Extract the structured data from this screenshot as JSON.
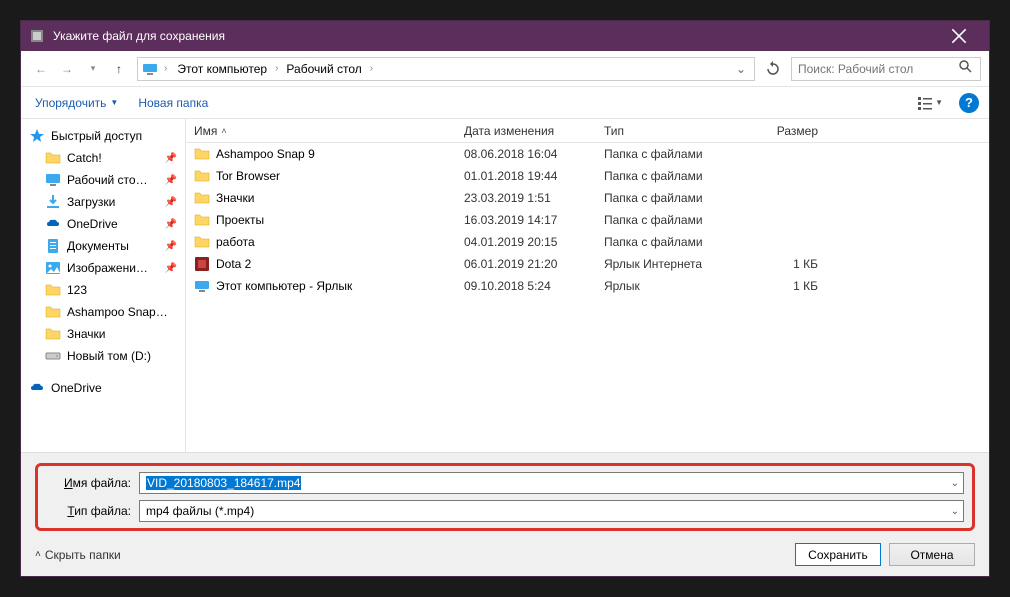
{
  "titlebar": {
    "title": "Укажите файл для сохранения"
  },
  "breadcrumb": {
    "root": "Этот компьютер",
    "items": [
      "Рабочий стол"
    ]
  },
  "search": {
    "placeholder": "Поиск: Рабочий стол"
  },
  "toolbar": {
    "organize": "Упорядочить",
    "new_folder": "Новая папка"
  },
  "columns": {
    "name": "Имя",
    "date": "Дата изменения",
    "type": "Тип",
    "size": "Размер"
  },
  "sidebar": {
    "quick_access": "Быстрый доступ",
    "items": [
      {
        "label": "Catch!",
        "icon": "folder",
        "pinned": true
      },
      {
        "label": "Рабочий сто…",
        "icon": "desktop",
        "pinned": true
      },
      {
        "label": "Загрузки",
        "icon": "download",
        "pinned": true
      },
      {
        "label": "OneDrive",
        "icon": "onedrive",
        "pinned": true
      },
      {
        "label": "Документы",
        "icon": "doc",
        "pinned": true
      },
      {
        "label": "Изображени…",
        "icon": "img",
        "pinned": true
      },
      {
        "label": "123",
        "icon": "folder",
        "pinned": false
      },
      {
        "label": "Ashampoo Snap…",
        "icon": "folder",
        "pinned": false
      },
      {
        "label": "Значки",
        "icon": "folder",
        "pinned": false
      },
      {
        "label": "Новый том (D:)",
        "icon": "drive",
        "pinned": false
      }
    ],
    "onedrive": "OneDrive"
  },
  "files": [
    {
      "name": "Ashampoo Snap 9",
      "date": "08.06.2018 16:04",
      "type": "Папка с файлами",
      "size": "",
      "icon": "folder"
    },
    {
      "name": "Tor Browser",
      "date": "01.01.2018 19:44",
      "type": "Папка с файлами",
      "size": "",
      "icon": "folder"
    },
    {
      "name": "Значки",
      "date": "23.03.2019 1:51",
      "type": "Папка с файлами",
      "size": "",
      "icon": "folder"
    },
    {
      "name": "Проекты",
      "date": "16.03.2019 14:17",
      "type": "Папка с файлами",
      "size": "",
      "icon": "folder"
    },
    {
      "name": "работа",
      "date": "04.01.2019 20:15",
      "type": "Папка с файлами",
      "size": "",
      "icon": "folder"
    },
    {
      "name": "Dota 2",
      "date": "06.01.2019 21:20",
      "type": "Ярлык Интернета",
      "size": "1 КБ",
      "icon": "shortcut-red"
    },
    {
      "name": "Этот компьютер - Ярлык",
      "date": "09.10.2018 5:24",
      "type": "Ярлык",
      "size": "1 КБ",
      "icon": "pc"
    }
  ],
  "fields": {
    "name_label_u": "И",
    "name_label_rest": "мя файла:",
    "name_value": "VID_20180803_184617.mp4",
    "type_label_u": "Т",
    "type_label_rest": "ип файла:",
    "type_value": "mp4 файлы (*.mp4)"
  },
  "buttons": {
    "hide_folders": "Скрыть папки",
    "save": "Сохранить",
    "cancel": "Отмена"
  }
}
